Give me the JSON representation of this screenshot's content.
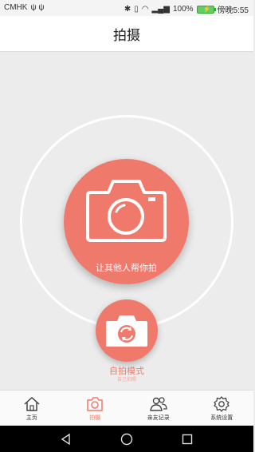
{
  "status_bar": {
    "carrier": "CMHK",
    "battery": "100%",
    "time": "傍晚5:55"
  },
  "header": {
    "title": "拍摄"
  },
  "main": {
    "others_label": "让其他人帮你拍",
    "selfie_label": "自拍模式",
    "selfie_sub": "自己拍照"
  },
  "tabs": [
    {
      "label": "主页",
      "icon": "home-icon"
    },
    {
      "label": "拍摄",
      "icon": "camera-icon",
      "active": true
    },
    {
      "label": "亲友记录",
      "icon": "people-icon"
    },
    {
      "label": "系统设置",
      "icon": "gear-icon"
    }
  ],
  "colors": {
    "accent": "#ef7a6c",
    "background": "#ececec"
  }
}
